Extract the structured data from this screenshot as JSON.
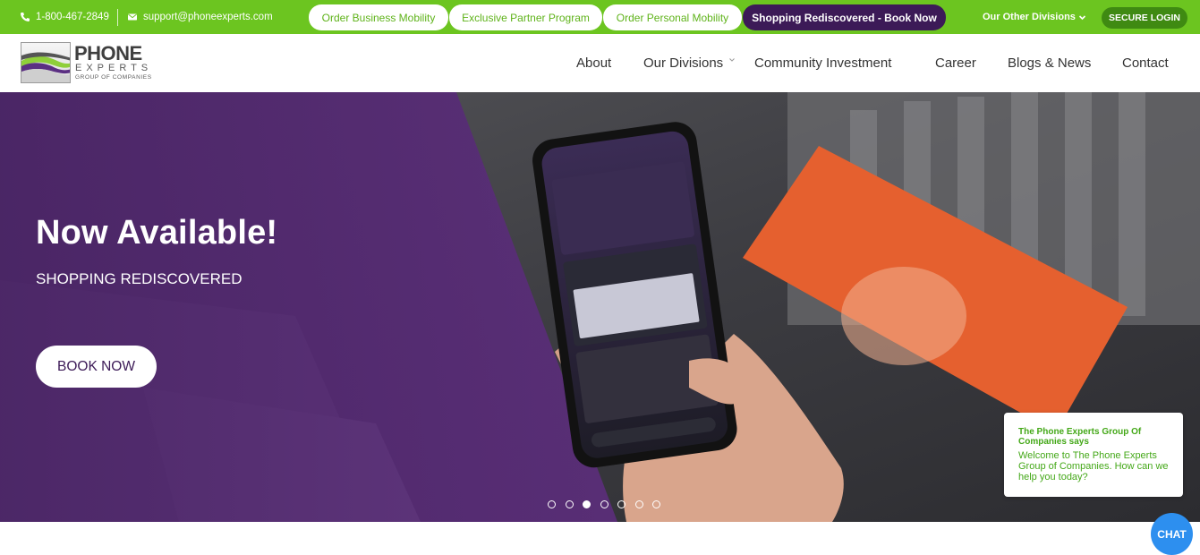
{
  "topbar": {
    "phone": "1-800-467-2849",
    "email": "support@phoneexperts.com",
    "pills": [
      {
        "label": "Order Business Mobility"
      },
      {
        "label": "Exclusive Partner Program"
      },
      {
        "label": "Order Personal Mobility"
      },
      {
        "label": "Shopping Rediscovered - Book Now"
      }
    ],
    "divisions_label": "Our Other Divisions",
    "login_label": "SECURE LOGIN"
  },
  "logo": {
    "line1": "PHONE",
    "line2": "EXPERTS",
    "line3": "GROUP OF COMPANIES"
  },
  "nav": [
    {
      "label": "About"
    },
    {
      "label": "Our Divisions"
    },
    {
      "label": "Community Investment"
    },
    {
      "label": "Career"
    },
    {
      "label": "Blogs & News"
    },
    {
      "label": "Contact"
    }
  ],
  "hero": {
    "title": "Now Available!",
    "subtitle": "SHOPPING REDISCOVERED",
    "button": "BOOK NOW",
    "slide_count": 7,
    "active_slide": 3
  },
  "chat": {
    "name": "The Phone Experts Group Of Companies says",
    "message": "Welcome to The Phone Experts Group of Companies. How can we help you today?",
    "button": "CHAT"
  },
  "colors": {
    "brand_green": "#6cc520",
    "brand_purple": "#3c1a57",
    "chat_blue": "#2d8fef"
  }
}
